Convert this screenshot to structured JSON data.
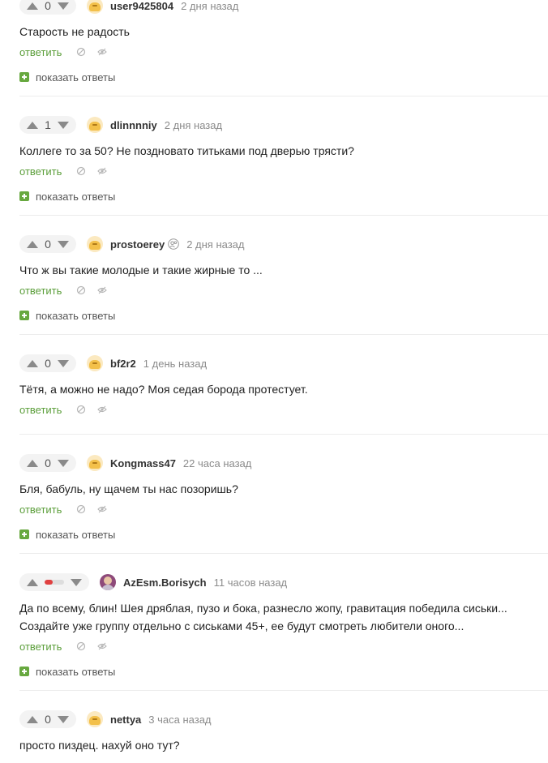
{
  "colors": {
    "reply_link": "#5b9e3a",
    "show_replies_icon": "#67a83f",
    "negative_rating": "#e04040",
    "muted_text": "#8b8b8b"
  },
  "comments": [
    {
      "rating": "0",
      "username": "user9425804",
      "time": "2 дня назад",
      "avatar_icon": "pikabu-avatar-icon",
      "lines": [
        "Старость не радость"
      ],
      "reply_label": "ответить",
      "show_replies_label": "показать ответы"
    },
    {
      "rating": "1",
      "username": "dlinnnniy",
      "time": "2 дня назад",
      "avatar_icon": "pikabu-avatar-icon",
      "lines": [
        "Коллеге то за 50? Не поздновато титьками под дверью трясти?"
      ],
      "reply_label": "ответить",
      "show_replies_label": "показать ответы"
    },
    {
      "rating": "0",
      "username": "prostoerey",
      "time": "2 дня назад",
      "avatar_icon": "pikabu-avatar-icon",
      "extra_icon": "subscriber-icon",
      "lines": [
        "Что ж вы такие молодые и такие жирные то ..."
      ],
      "reply_label": "ответить",
      "show_replies_label": "показать ответы"
    },
    {
      "rating": "0",
      "username": "bf2r2",
      "time": "1 день назад",
      "avatar_icon": "pikabu-avatar-icon",
      "lines": [
        "Тётя, а можно не надо? Моя седая борода протестует."
      ],
      "reply_label": "ответить"
    },
    {
      "rating": "0",
      "username": "Kongmass47",
      "time": "22 часа назад",
      "avatar_icon": "pikabu-avatar-icon",
      "lines": [
        "Бля, бабуль, ну щачем ты нас позоришь?"
      ],
      "reply_label": "ответить",
      "show_replies_label": "показать ответы"
    },
    {
      "rating_bar_negative_fraction": 0.4,
      "username": "AzEsm.Borisych",
      "time": "11 часов назад",
      "avatar_icon": "user-photo-avatar-icon",
      "lines": [
        "Да по всему, блин! Шея дряблая, пузо и бока, разнесло жопу, гравитация победила сиськи...",
        "Создайте уже группу отдельно с сиськами 45+, ее будут смотреть любители оного..."
      ],
      "reply_label": "ответить",
      "show_replies_label": "показать ответы"
    },
    {
      "rating": "0",
      "username": "nettya",
      "time": "3 часа назад",
      "avatar_icon": "pikabu-avatar-icon",
      "lines": [
        "просто пиздец. нахуй оно тут?"
      ]
    }
  ]
}
